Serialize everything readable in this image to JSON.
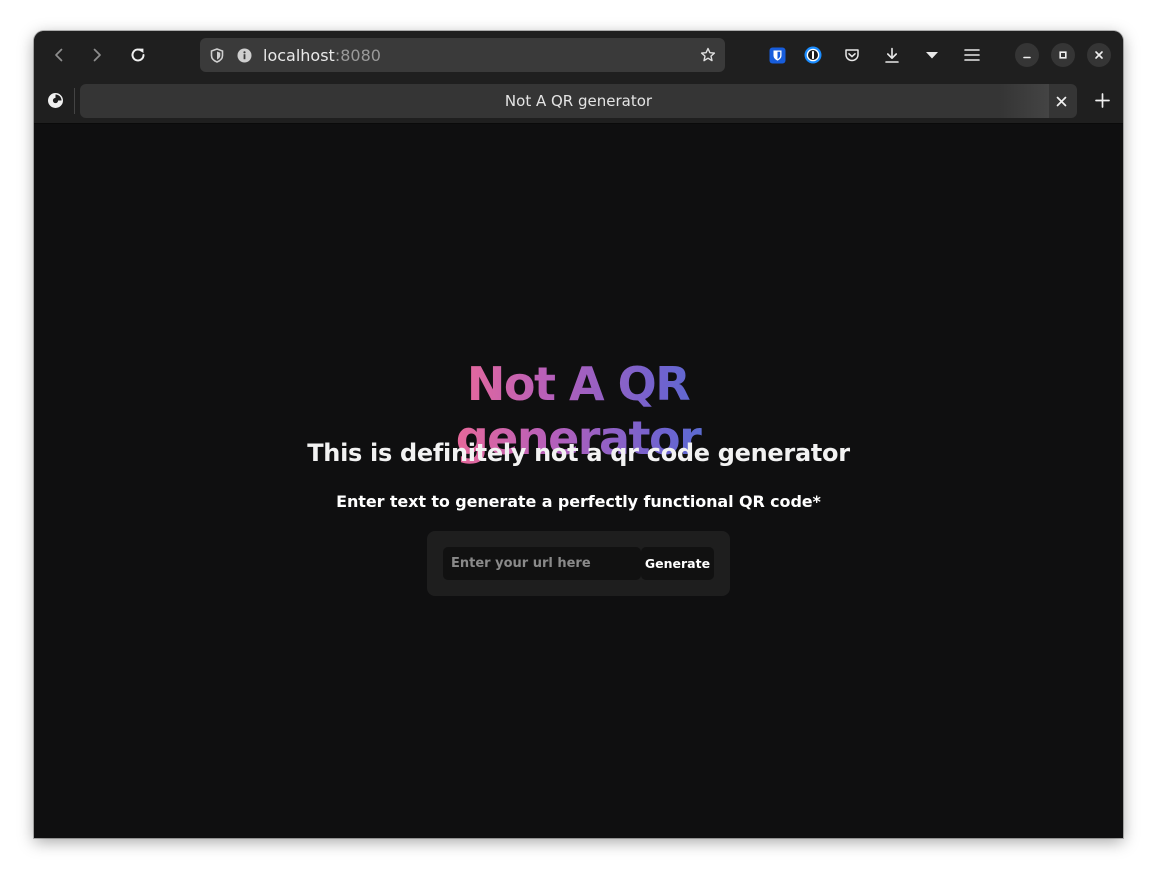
{
  "browser": {
    "url_host": "localhost",
    "url_port": ":8080",
    "tab_title": "Not A QR generator",
    "icons": [
      "back-arrow-icon",
      "forward-arrow-icon",
      "reload-icon",
      "shield-icon",
      "info-icon",
      "star-icon",
      "bitwarden-icon",
      "onepassword-icon",
      "pocket-icon",
      "download-icon",
      "dropdown-arrow-icon",
      "hamburger-menu-icon",
      "minimize-icon",
      "maximize-icon",
      "close-icon",
      "firefox-view-icon",
      "tab-close-icon",
      "new-tab-icon"
    ]
  },
  "page": {
    "title": "Not A QR generator",
    "subtitle": "This is definitely not a qr code generator",
    "instruction": "Enter text to generate a perfectly functional QR code*",
    "input_placeholder": "Enter your url here",
    "input_value": "",
    "button_label": "Generate"
  },
  "colors": {
    "gradient_start": "#ff6b8b",
    "gradient_end": "#1f84d6",
    "background": "#0f0f10"
  }
}
